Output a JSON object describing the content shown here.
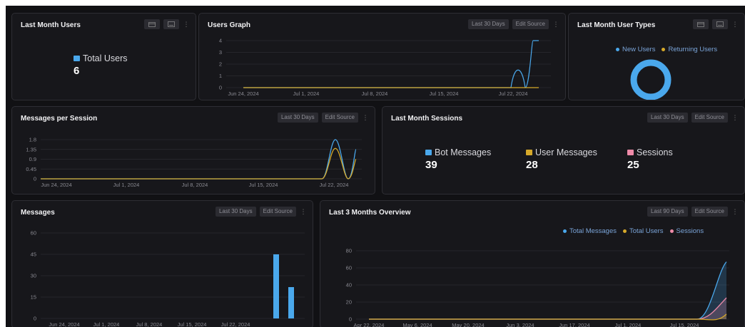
{
  "common": {
    "edit_source": "Edit Source",
    "last30": "Last 30 Days",
    "last90": "Last 90 Days",
    "kebab": "⋮"
  },
  "colors": {
    "blue": "#4aa8ec",
    "yellow": "#d6a92a",
    "pink": "#ee8aa8"
  },
  "cards": {
    "last_month_users": {
      "title": "Last Month Users",
      "stat_label": "Total Users",
      "stat_value": "6"
    },
    "users_graph": {
      "title": "Users Graph"
    },
    "user_types": {
      "title": "Last Month User Types",
      "legend": [
        "New Users",
        "Returning Users"
      ]
    },
    "messages_per_session": {
      "title": "Messages per Session"
    },
    "last_month_sessions": {
      "title": "Last Month Sessions",
      "stats": [
        {
          "label": "Bot Messages",
          "value": "39"
        },
        {
          "label": "User Messages",
          "value": "28"
        },
        {
          "label": "Sessions",
          "value": "25"
        }
      ]
    },
    "messages": {
      "title": "Messages"
    },
    "overview": {
      "title": "Last 3 Months Overview",
      "legend": [
        "Total Messages",
        "Total Users",
        "Sessions"
      ]
    }
  },
  "chart_data": [
    {
      "id": "users_graph",
      "type": "line",
      "x_ticks": [
        "Jun 24, 2024",
        "Jul 1, 2024",
        "Jul 8, 2024",
        "Jul 15, 2024",
        "Jul 22, 2024"
      ],
      "y_ticks": [
        "0",
        "1",
        "2",
        "3",
        "4"
      ],
      "ylim": [
        0,
        4
      ],
      "x": [
        "Jun 24",
        "Jul 19",
        "Jul 20",
        "Jul 21",
        "Jul 22",
        "Jul 23"
      ],
      "series": [
        {
          "values": [
            0,
            0,
            2,
            0,
            4,
            4
          ]
        },
        {
          "values": [
            0,
            0,
            0,
            0,
            0,
            0
          ]
        }
      ]
    },
    {
      "id": "messages_per_session",
      "type": "line",
      "x_ticks": [
        "Jun 24, 2024",
        "Jul 1, 2024",
        "Jul 8, 2024",
        "Jul 15, 2024",
        "Jul 22, 2024"
      ],
      "y_ticks": [
        "0",
        "0.45",
        "0.9",
        "1.35",
        "1.8"
      ],
      "ylim": [
        0,
        1.8
      ],
      "x": [
        "Jun 24",
        "Jul 19",
        "Jul 20",
        "Jul 21",
        "Jul 22"
      ],
      "series": [
        {
          "values": [
            0,
            0,
            1.8,
            0,
            1.35
          ]
        },
        {
          "values": [
            0,
            0,
            1.4,
            0,
            0.9
          ]
        }
      ]
    },
    {
      "id": "user_types",
      "type": "pie",
      "categories": [
        "New Users",
        "Returning Users"
      ],
      "values": [
        6,
        0
      ]
    },
    {
      "id": "messages",
      "type": "bar",
      "x_ticks": [
        "Jun 24, 2024",
        "Jul 1, 2024",
        "Jul 8, 2024",
        "Jul 15, 2024",
        "Jul 22, 2024"
      ],
      "y_ticks": [
        "0",
        "15",
        "30",
        "45",
        "60"
      ],
      "ylim": [
        0,
        60
      ],
      "categories": [
        "Jul 20",
        "Jul 23"
      ],
      "values": [
        45,
        22
      ]
    },
    {
      "id": "overview",
      "type": "area",
      "x_ticks": [
        "Apr 22, 2024",
        "May 6, 2024",
        "May 20, 2024",
        "Jun 3, 2024",
        "Jun 17, 2024",
        "Jul 1, 2024",
        "Jul 15, 2024"
      ],
      "y_ticks": [
        "0",
        "20",
        "40",
        "60",
        "80"
      ],
      "ylim": [
        0,
        80
      ],
      "x": [
        "Apr 22",
        "Jul 13",
        "Jul 22"
      ],
      "series": [
        {
          "name": "Total Messages",
          "values": [
            0,
            0,
            67
          ]
        },
        {
          "name": "Total Users",
          "values": [
            0,
            0,
            6
          ]
        },
        {
          "name": "Sessions",
          "values": [
            0,
            0,
            25
          ]
        }
      ]
    }
  ]
}
